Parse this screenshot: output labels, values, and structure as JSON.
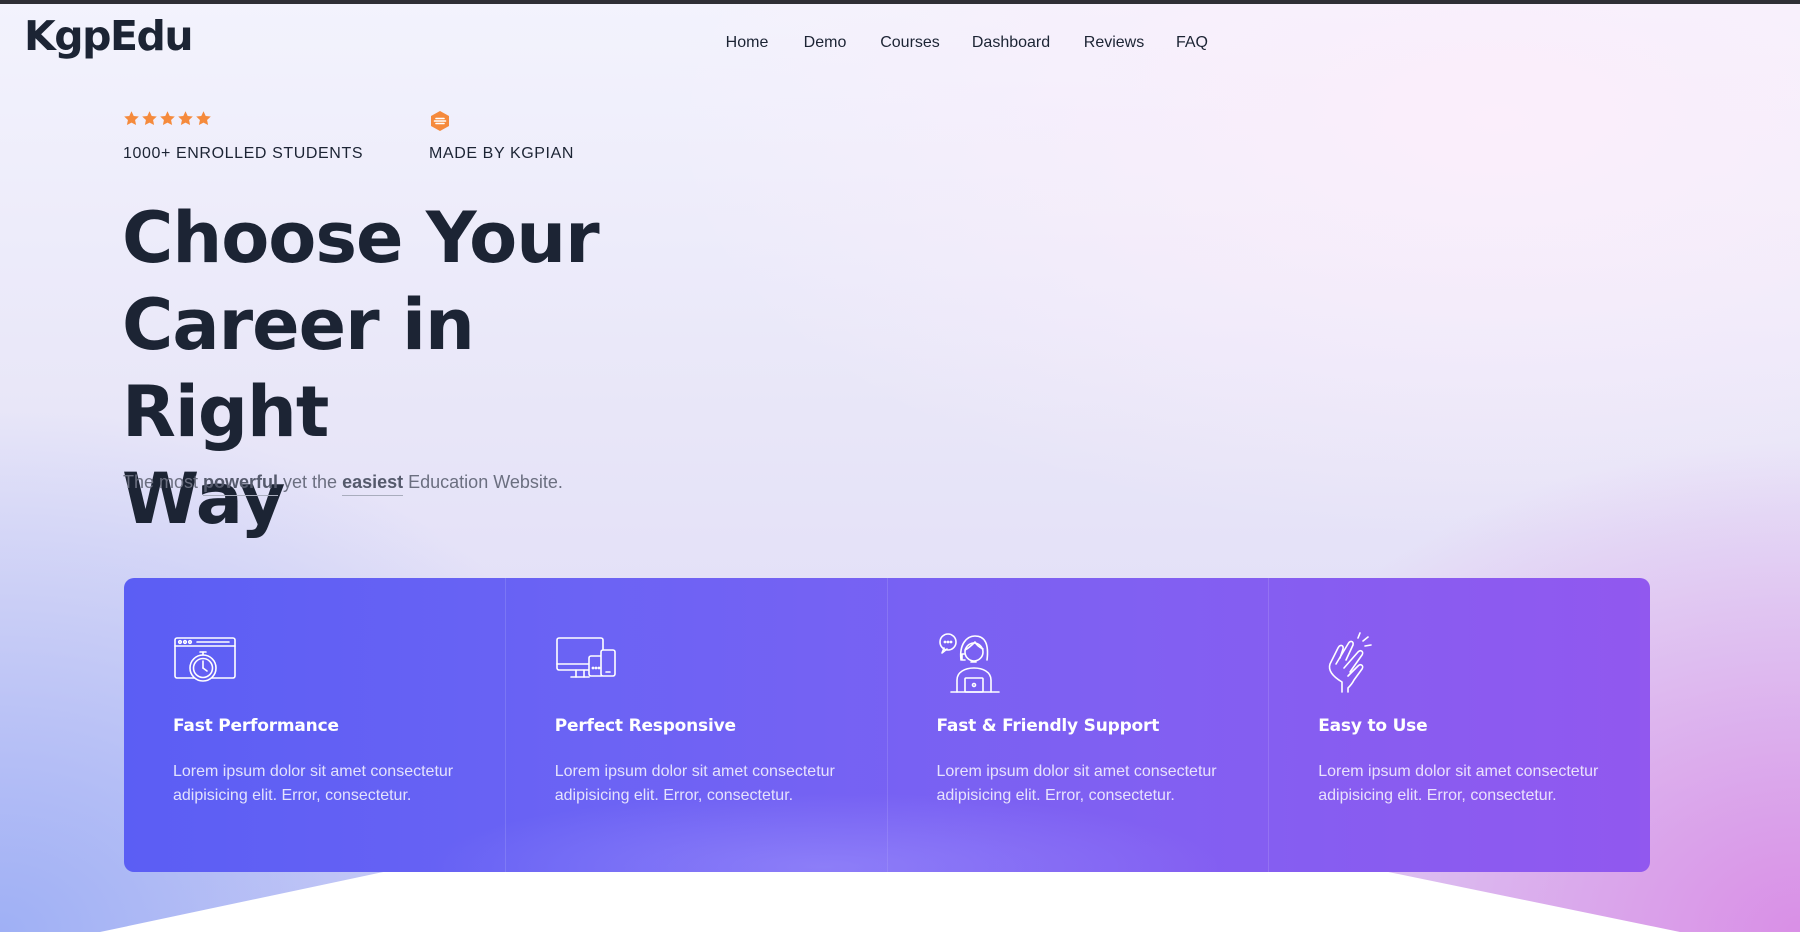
{
  "brand": {
    "logo": "KgpEdu"
  },
  "nav": {
    "items": [
      {
        "label": "Home"
      },
      {
        "label": "Demo"
      },
      {
        "label": "Courses"
      },
      {
        "label": "Dashboard"
      },
      {
        "label": "Reviews"
      },
      {
        "label": "FAQ"
      }
    ]
  },
  "badges": {
    "rating": {
      "stars": 5,
      "text": "1000+ ENROLLED STUDENTS",
      "icon": "star-icon",
      "color": "#f58a3c"
    },
    "maker": {
      "text": "MADE BY KGPIAN",
      "icon": "hexagon-lines-icon",
      "color": "#f58a3c"
    }
  },
  "hero": {
    "title_lines": [
      "Choose Your",
      "Career in Right",
      "Way"
    ],
    "subtitle": {
      "part1": "The most ",
      "em1": "powerful",
      "part2": " yet the ",
      "em2": "easiest",
      "part3": " Education Website."
    }
  },
  "features": [
    {
      "icon": "stopwatch-browser-icon",
      "title": "Fast Performance",
      "desc": "Lorem ipsum dolor sit amet consectetur adipisicing elit. Error, consectetur."
    },
    {
      "icon": "devices-icon",
      "title": "Perfect Responsive",
      "desc": "Lorem ipsum dolor sit amet consectetur adipisicing elit. Error, consectetur."
    },
    {
      "icon": "support-agent-icon",
      "title": "Fast & Friendly Support",
      "desc": "Lorem ipsum dolor sit amet consectetur adipisicing elit. Error, consectetur."
    },
    {
      "icon": "hand-gesture-icon",
      "title": "Easy to Use",
      "desc": "Lorem ipsum dolor sit amet consectetur adipisicing elit. Error, consectetur."
    }
  ],
  "colors": {
    "text_dark": "#1c2434",
    "accent_orange": "#f58a3c",
    "features_start": "#5b5ef4",
    "features_end": "#9158ef"
  }
}
